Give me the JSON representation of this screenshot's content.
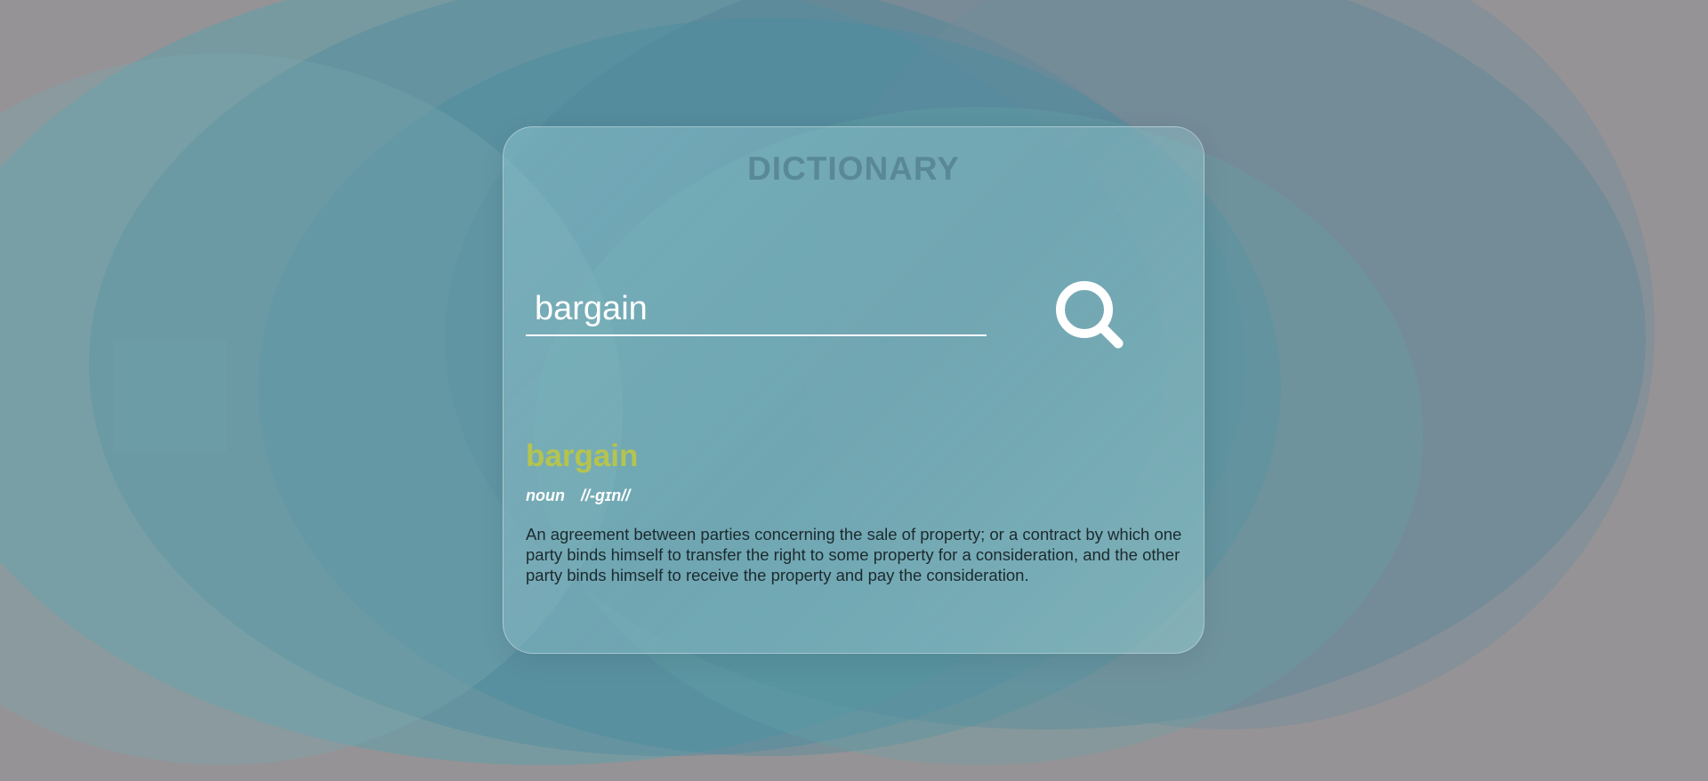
{
  "app": {
    "title": "DICTIONARY"
  },
  "search": {
    "value": "bargain",
    "placeholder": ""
  },
  "result": {
    "word": "bargain",
    "part_of_speech": "noun",
    "phonetic": "//-gɪn//",
    "definition": "An agreement between parties concerning the sale of property; or a contract by which one party binds himself to transfer the right to some property for a consideration, and the other party binds himself to receive the property and pay the consideration."
  },
  "icons": {
    "search_button": "search-icon"
  },
  "colors": {
    "background": "#959396",
    "word_accent": "#b5c44e",
    "card_title": "#466e7d",
    "input_text": "#ffffff",
    "definition_text": "#1c2a2e"
  }
}
